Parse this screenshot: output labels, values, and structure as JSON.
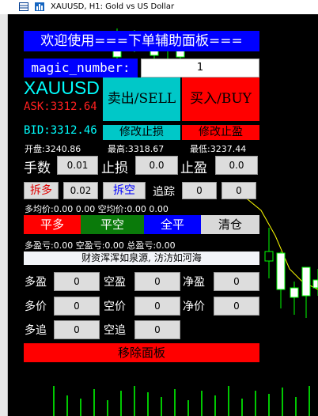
{
  "window": {
    "title": "XAUUSD, H1:  Gold vs US Dollar"
  },
  "panel": {
    "banner": "欢迎使用===下单辅助面板===",
    "magic_label": "magic_number:",
    "magic_value": "1",
    "symbol": "XAUUSD",
    "ask": "ASK:3312.64",
    "bid": "BID:3312.46",
    "sell_button": "卖出/SELL",
    "buy_button": "买入/BUY",
    "modify_sl_button": "修改止损",
    "modify_tp_button": "修改止盈",
    "open_price": "开盘:3240.86",
    "high_price": "最高:3318.67",
    "low_price": "最低:3237.44",
    "lots_label": "手数",
    "lots_value": "0.01",
    "sl_label": "止损",
    "sl_value": "0.0",
    "tp_label": "止盈",
    "tp_value": "0.0",
    "split_long_button": "拆多",
    "split_long_value": "0.02",
    "split_short_button": "拆空",
    "trail_label": "追踪",
    "trail_value_1": "0",
    "trail_value_2": "0",
    "avg_info": "多均价:0.00  0.00 空均价:0.00  0.00",
    "close_long_button": "平多",
    "close_short_button": "平空",
    "close_all_button": "全平",
    "clear_button": "清仓",
    "pnl_info": "多盈亏:0.00  空盈亏:0.00 总盈亏:0.00",
    "motto": "财资浑浑如泉源, 汸汸如河海",
    "long_tp_label": "多盈",
    "long_tp_value": "0",
    "short_tp_label": "空盈",
    "short_tp_value": "0",
    "net_tp_label": "净盈",
    "net_tp_value": "0",
    "long_price_label": "多价",
    "long_price_value": "0",
    "short_price_label": "空价",
    "short_price_value": "0",
    "net_price_label": "净价",
    "net_price_value": "0",
    "long_trail_label": "多追",
    "long_trail_value": "0",
    "short_trail_label": "空追",
    "short_trail_value": "0",
    "remove_panel_button": "移除面板"
  },
  "colors": {
    "blue": "#0000ff",
    "red": "#ff0000",
    "cyan": "#00c8c8",
    "green": "#0a7a0a",
    "volume": "#00c800"
  }
}
